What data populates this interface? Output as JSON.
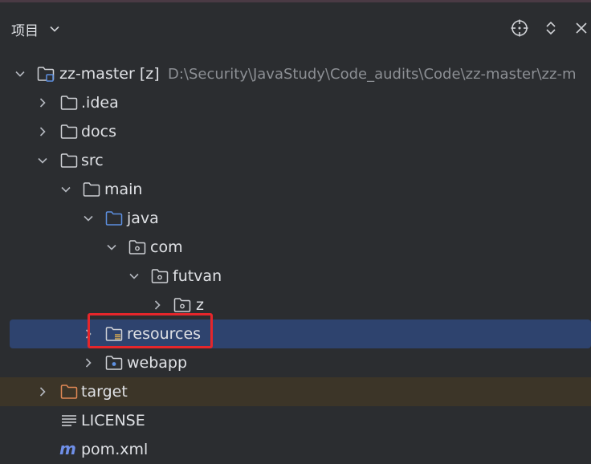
{
  "panel": {
    "title": "项目"
  },
  "tree": {
    "root": {
      "label": "zz-master [z]",
      "path": "D:\\Security\\JavaStudy\\Code_audits\\Code\\zz-master\\zz-m"
    },
    "idea": {
      "label": ".idea"
    },
    "docs": {
      "label": "docs"
    },
    "src": {
      "label": "src"
    },
    "main": {
      "label": "main"
    },
    "java": {
      "label": "java"
    },
    "com": {
      "label": "com"
    },
    "futvan": {
      "label": "futvan"
    },
    "z": {
      "label": "z"
    },
    "resources": {
      "label": "resources"
    },
    "webapp": {
      "label": "webapp"
    },
    "target": {
      "label": "target"
    },
    "license": {
      "label": "LICENSE"
    },
    "pom": {
      "label": "pom.xml"
    }
  },
  "colors": {
    "selection": "#2e436e",
    "excluded_row": "#3c3528",
    "highlight_border": "#e5262b",
    "source_folder": "#5d8fe0",
    "excluded_folder": "#e08855",
    "maven": "#6f8fe8"
  },
  "icons": {
    "locate": "crosshair-icon",
    "expand_collapse": "expand-collapse-icon",
    "close": "close-icon",
    "folder": "folder-icon",
    "package": "package-icon",
    "resources": "resources-folder-icon",
    "web": "web-folder-icon",
    "text_file": "text-file-icon",
    "maven": "maven-icon"
  }
}
